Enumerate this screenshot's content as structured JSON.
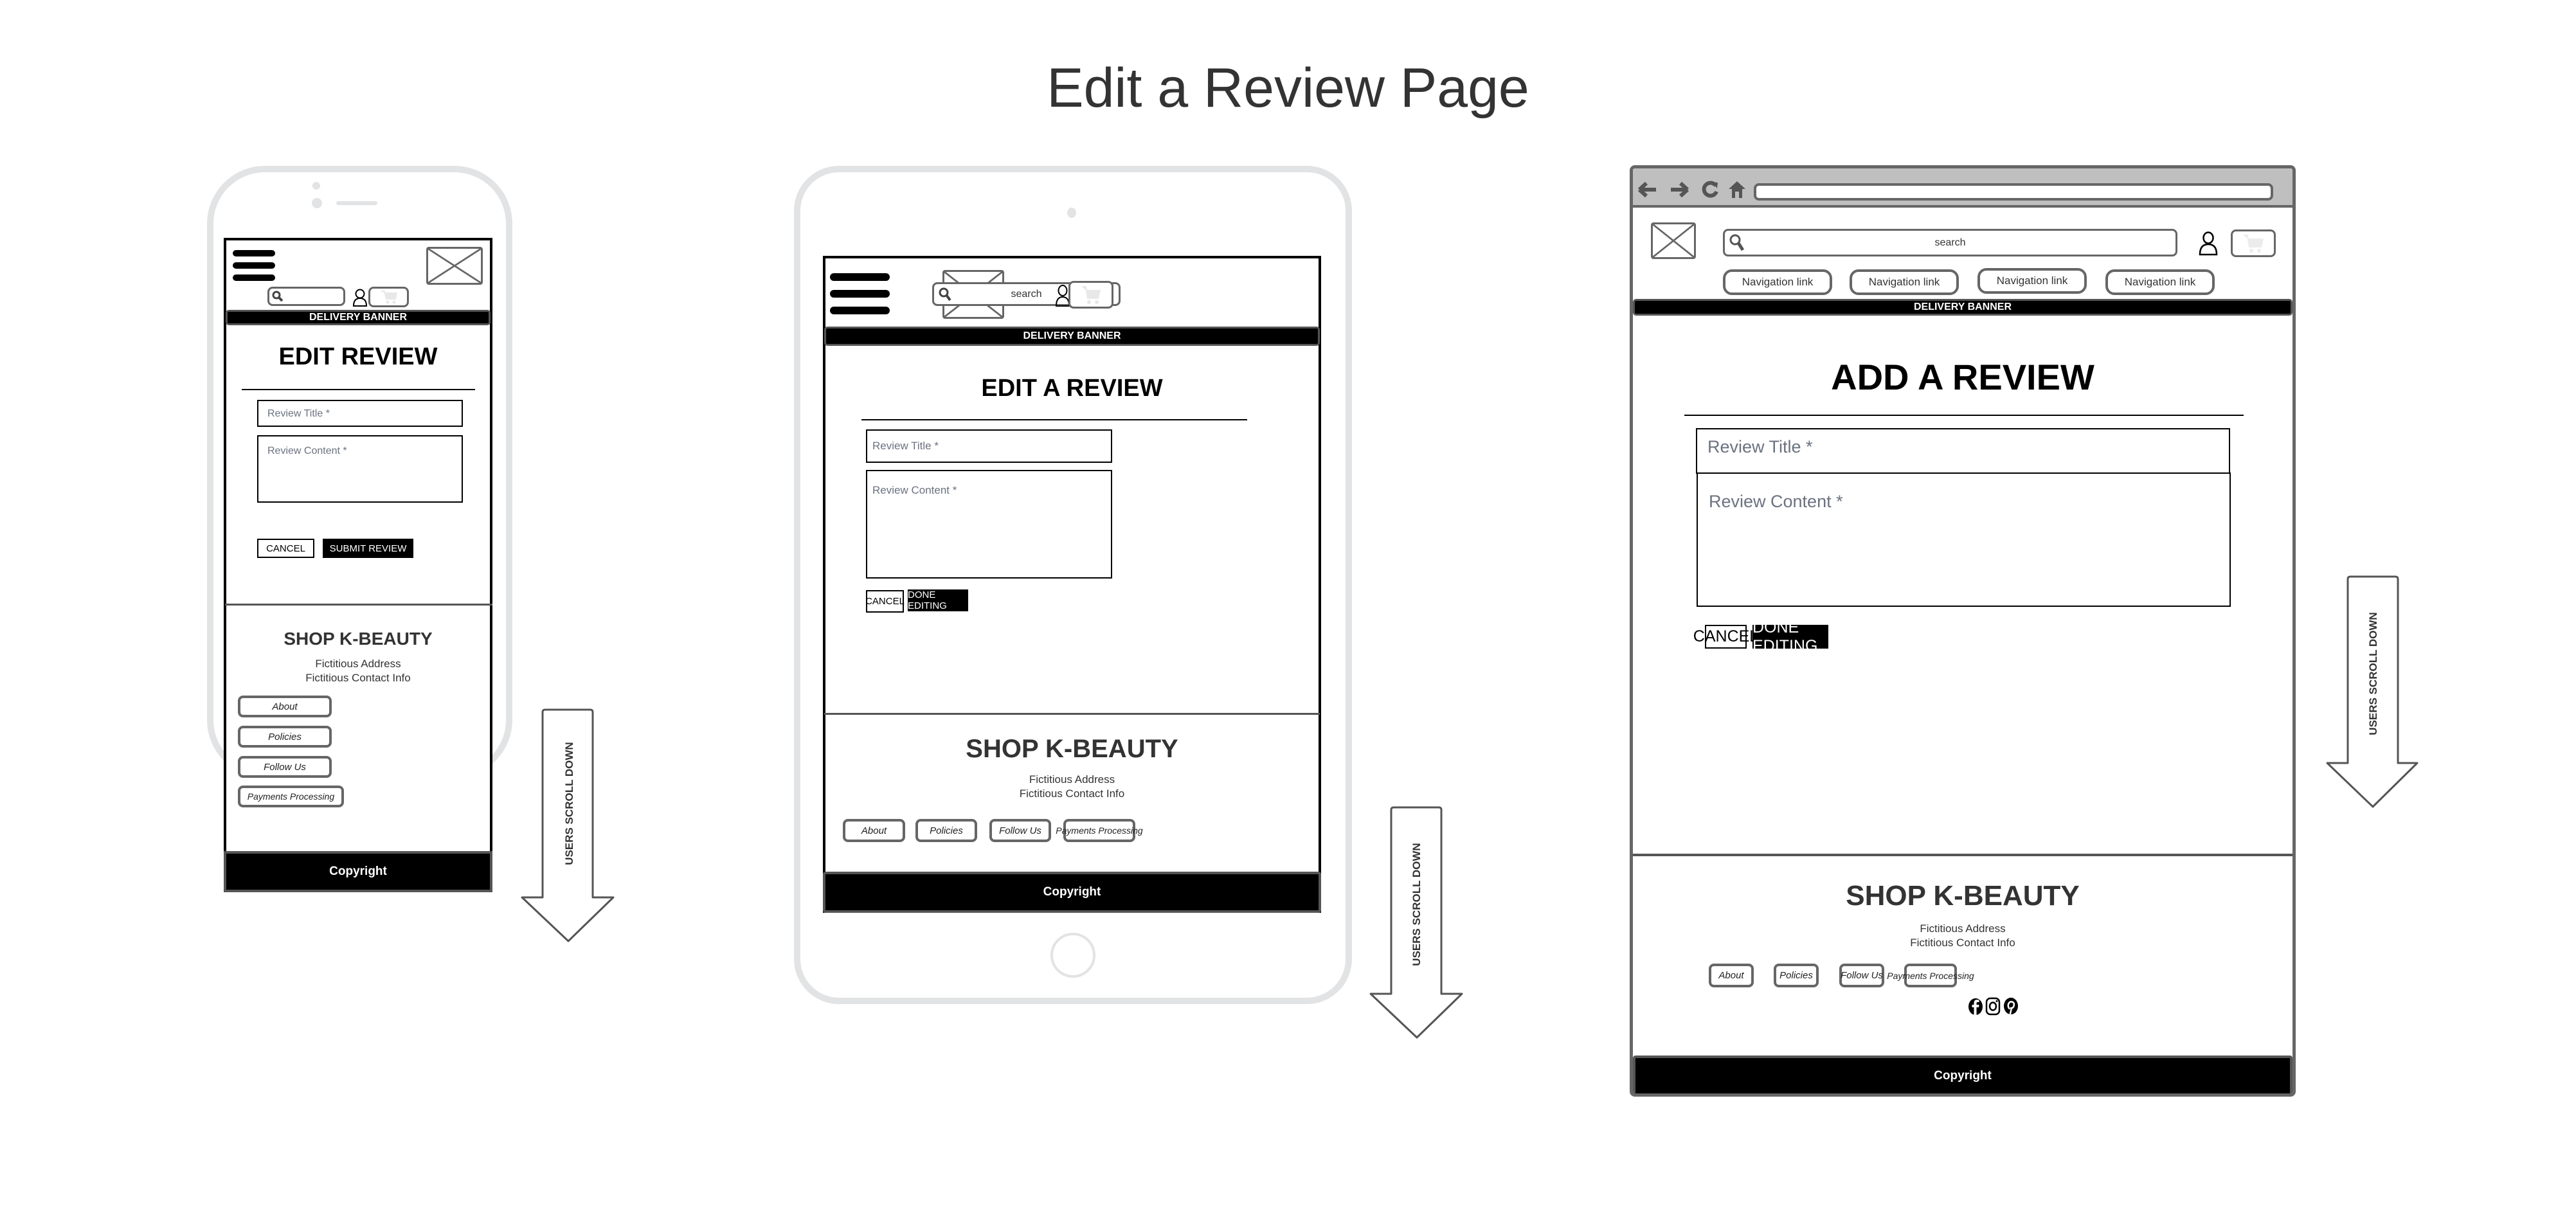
{
  "page": {
    "title": "Edit a Review Page"
  },
  "annotation": {
    "scroll_label": "USERS SCROLL DOWN"
  },
  "mobile": {
    "header": {
      "banner": "DELIVERY BANNER"
    },
    "main": {
      "heading": "EDIT REVIEW",
      "title_placeholder": "Review Title *",
      "content_placeholder": "Review Content *",
      "cancel_label": "CANCEL",
      "submit_label": "SUBMIT REVIEW"
    },
    "footer": {
      "brand": "SHOP K-BEAUTY",
      "address": "Fictitious Address",
      "contact": "Fictitious Contact Info",
      "links": [
        "About",
        "Policies",
        "Follow Us",
        "Payments Processing"
      ],
      "copyright": "Copyright"
    }
  },
  "tablet": {
    "header": {
      "search_placeholder": "search",
      "banner": "DELIVERY BANNER"
    },
    "main": {
      "heading": "EDIT A REVIEW",
      "title_placeholder": "Review Title *",
      "content_placeholder": "Review Content *",
      "cancel_label": "CANCEL",
      "submit_label": "DONE EDITING"
    },
    "footer": {
      "brand": "SHOP K-BEAUTY",
      "address": "Fictitious Address",
      "contact": "Fictitious Contact Info",
      "links": [
        "About",
        "Policies",
        "Follow Us",
        "Payments Processing"
      ],
      "copyright": "Copyright"
    }
  },
  "desktop": {
    "header": {
      "search_placeholder": "search",
      "nav_links": [
        "Navigation link",
        "Navigation link",
        "Navigation link",
        "Navigation link"
      ],
      "banner": "DELIVERY BANNER"
    },
    "main": {
      "heading": "ADD A REVIEW",
      "title_placeholder": "Review Title *",
      "content_placeholder": "Review Content *",
      "cancel_label": "CANCEL",
      "submit_label": "DONE EDITING"
    },
    "footer": {
      "brand": "SHOP K-BEAUTY",
      "address": "Fictitious Address",
      "contact": "Fictitious Contact Info",
      "links": [
        "About",
        "Policies",
        "Follow Us",
        "Payments Processing"
      ],
      "social_icons": [
        "facebook-icon",
        "instagram-icon",
        "pinterest-icon"
      ],
      "copyright": "Copyright"
    }
  }
}
